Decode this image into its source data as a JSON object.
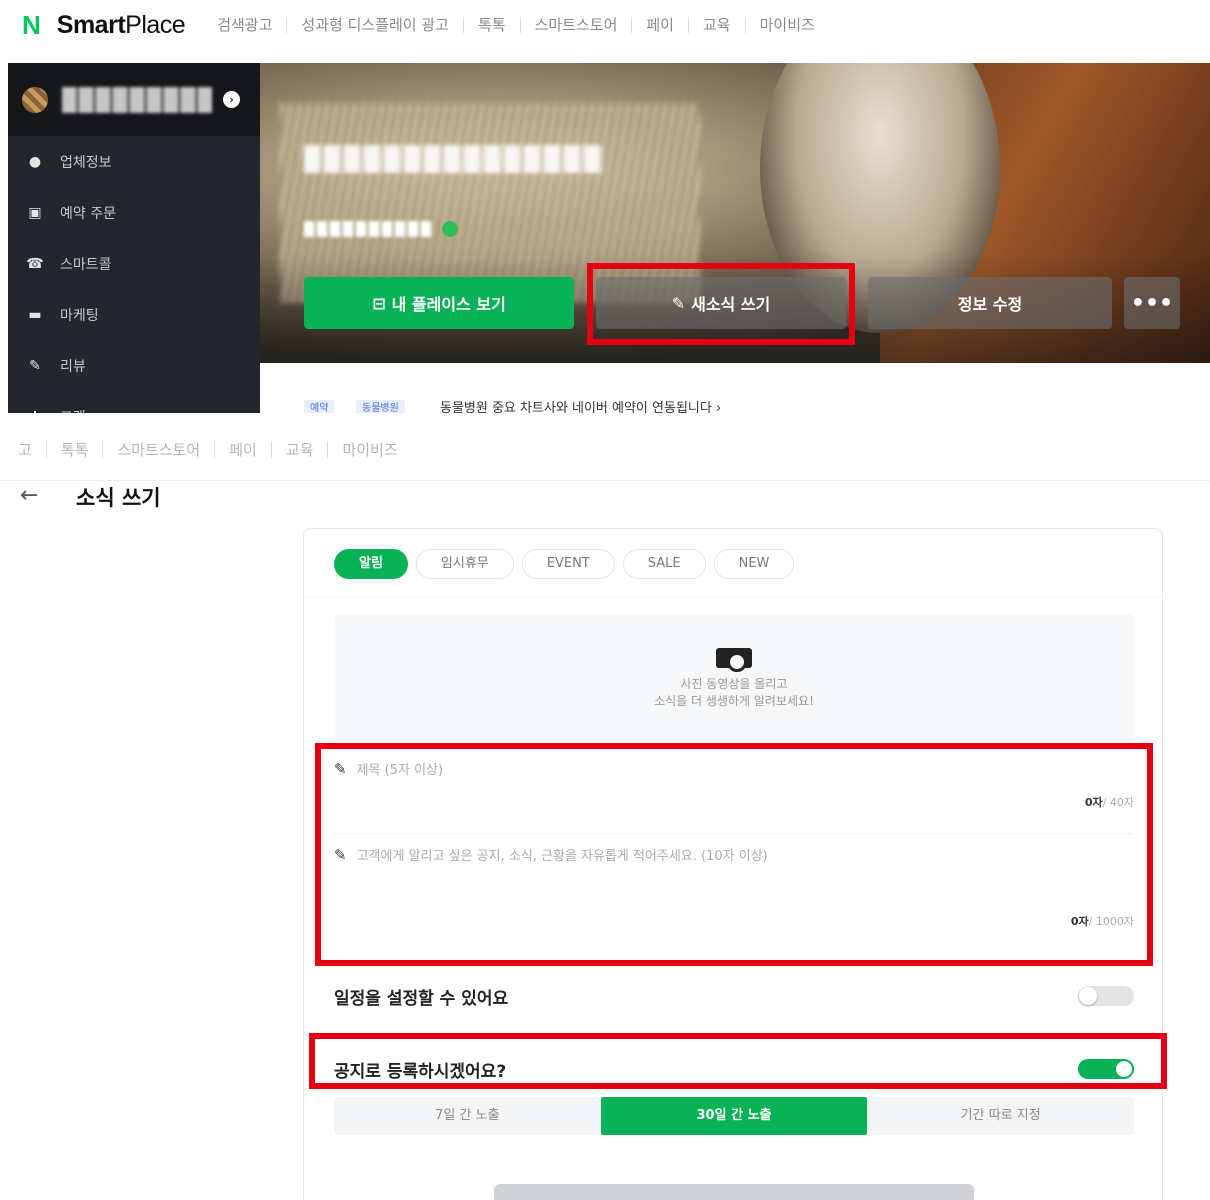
{
  "header": {
    "logo_n": "N",
    "logo_text_bold": "Smart",
    "logo_text": "Place",
    "nav": [
      "검색광고",
      "성과형 디스플레이 광고",
      "톡톡",
      "스마트스토어",
      "페이",
      "교육",
      "마이비즈"
    ]
  },
  "sidebar": {
    "items": [
      {
        "label": "업체정보",
        "icon": "info-icon"
      },
      {
        "label": "예약 주문",
        "icon": "calendar-icon"
      },
      {
        "label": "스마트콜",
        "icon": "phone-icon"
      },
      {
        "label": "마케팅",
        "icon": "chat-icon"
      },
      {
        "label": "리뷰",
        "icon": "pen-icon"
      },
      {
        "label": "고객",
        "icon": "person-icon"
      }
    ]
  },
  "hero": {
    "buttons": {
      "my_place": "내 플레이스 보기",
      "new_post": "새소식 쓰기",
      "edit_info": "정보 수정",
      "more": "•••"
    },
    "notice": {
      "badge1": "예약",
      "badge2": "동물병원",
      "text": "동물병원 중요 차트사와 네이버 예약이 연동됩니다 ›"
    }
  },
  "editor": {
    "nav": [
      "고",
      "톡톡",
      "스마트스토어",
      "페이",
      "교육",
      "마이비즈"
    ],
    "back": "←",
    "title": "소식 쓰기",
    "tabs": [
      "알림",
      "임시휴무",
      "EVENT",
      "SALE",
      "NEW"
    ],
    "active_tab": "알림",
    "upload_line1": "사진 동영상을 올리고",
    "upload_line2": "소식을 더 생생하게 알려보세요!",
    "title_placeholder": "제목 (5자 이상)",
    "title_count": "0자",
    "title_max": "/ 40자",
    "body_placeholder": "고객에게 알리고 싶은 공지, 소식, 근황을 자유롭게 적어주세요. (10자 이상)",
    "body_count": "0자",
    "body_max": "/ 1000자",
    "schedule_label": "일정을 설정할 수 있어요",
    "schedule_on": false,
    "notice_label": "공지로 등록하시겠어요?",
    "notice_on": true,
    "periods": [
      "7일 간 노출",
      "30일 간 노출",
      "기간 따로 지정"
    ],
    "active_period": "30일 간 노출"
  },
  "colors": {
    "brand_green": "#09b157",
    "highlight_red": "#e60012",
    "sidebar_bg": "#23262b"
  }
}
